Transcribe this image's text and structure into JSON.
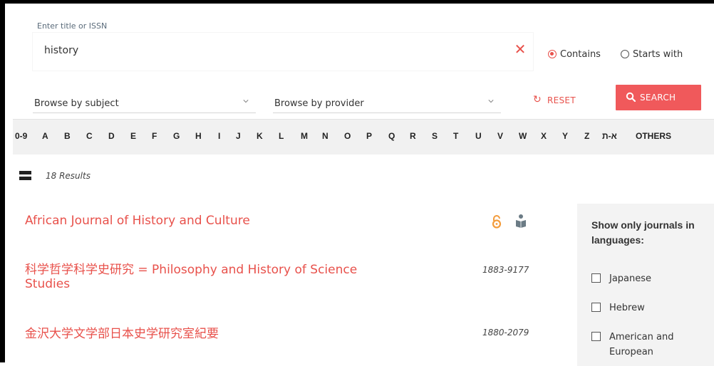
{
  "search": {
    "label": "Enter title or ISSN",
    "value": "history",
    "mode_contains": "Contains",
    "mode_starts_with": "Starts with"
  },
  "browse": {
    "subject": "Browse by subject",
    "provider": "Browse by provider",
    "reset": "RESET",
    "search": "SEARCH"
  },
  "alphabet": [
    "0-9",
    "A",
    "B",
    "C",
    "D",
    "E",
    "F",
    "G",
    "H",
    "I",
    "J",
    "K",
    "L",
    "M",
    "N",
    "O",
    "P",
    "Q",
    "R",
    "S",
    "T",
    "U",
    "V",
    "W",
    "X",
    "Y",
    "Z",
    "א-ת",
    "OTHERS"
  ],
  "results": {
    "count": "18 Results",
    "items": [
      {
        "title": "African Journal of History and Culture",
        "issn": ""
      },
      {
        "title_line1": "科学哲学科学史研究 = Philosophy and History of Science",
        "title_line2": "Studies",
        "issn": "1883-9177"
      },
      {
        "title": "金沢大学文学部日本史学研究室紀要",
        "issn": "1880-2079"
      }
    ]
  },
  "languages": {
    "title": "Show only journals in languages:",
    "options": [
      "Japanese",
      "Hebrew",
      "American and European"
    ]
  },
  "colors": {
    "accent": "#e8514b",
    "button": "#f0595b",
    "open_access": "#f39c3c",
    "book_icon": "#6b7b85"
  },
  "icons": [
    "clear-icon",
    "chevron-down-icon",
    "reset-icon",
    "search-icon",
    "open-access-icon",
    "book-icon",
    "list-view-icon"
  ]
}
